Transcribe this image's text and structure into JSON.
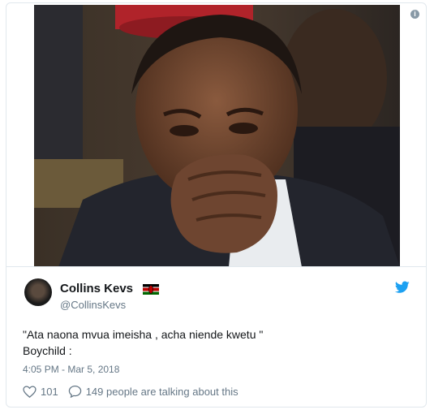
{
  "tweet": {
    "author_name": "Collins Kevs",
    "author_handle": "@CollinsKevs",
    "text_line1": "\"Ata naona mvua imeisha , acha niende kwetu \"",
    "text_line2": "Boychild :",
    "timestamp": "4:05 PM - Mar 5, 2018",
    "likes": "101",
    "talking": "149 people are talking about this"
  },
  "icons": {
    "info": "info-icon",
    "brand": "twitter-bird-icon",
    "flag": "kenya-flag-icon",
    "like": "heart-icon",
    "reply": "speech-bubble-icon"
  },
  "colors": {
    "brand_blue": "#1da1f2",
    "muted_text": "#657786",
    "border": "#e1e8ed"
  }
}
